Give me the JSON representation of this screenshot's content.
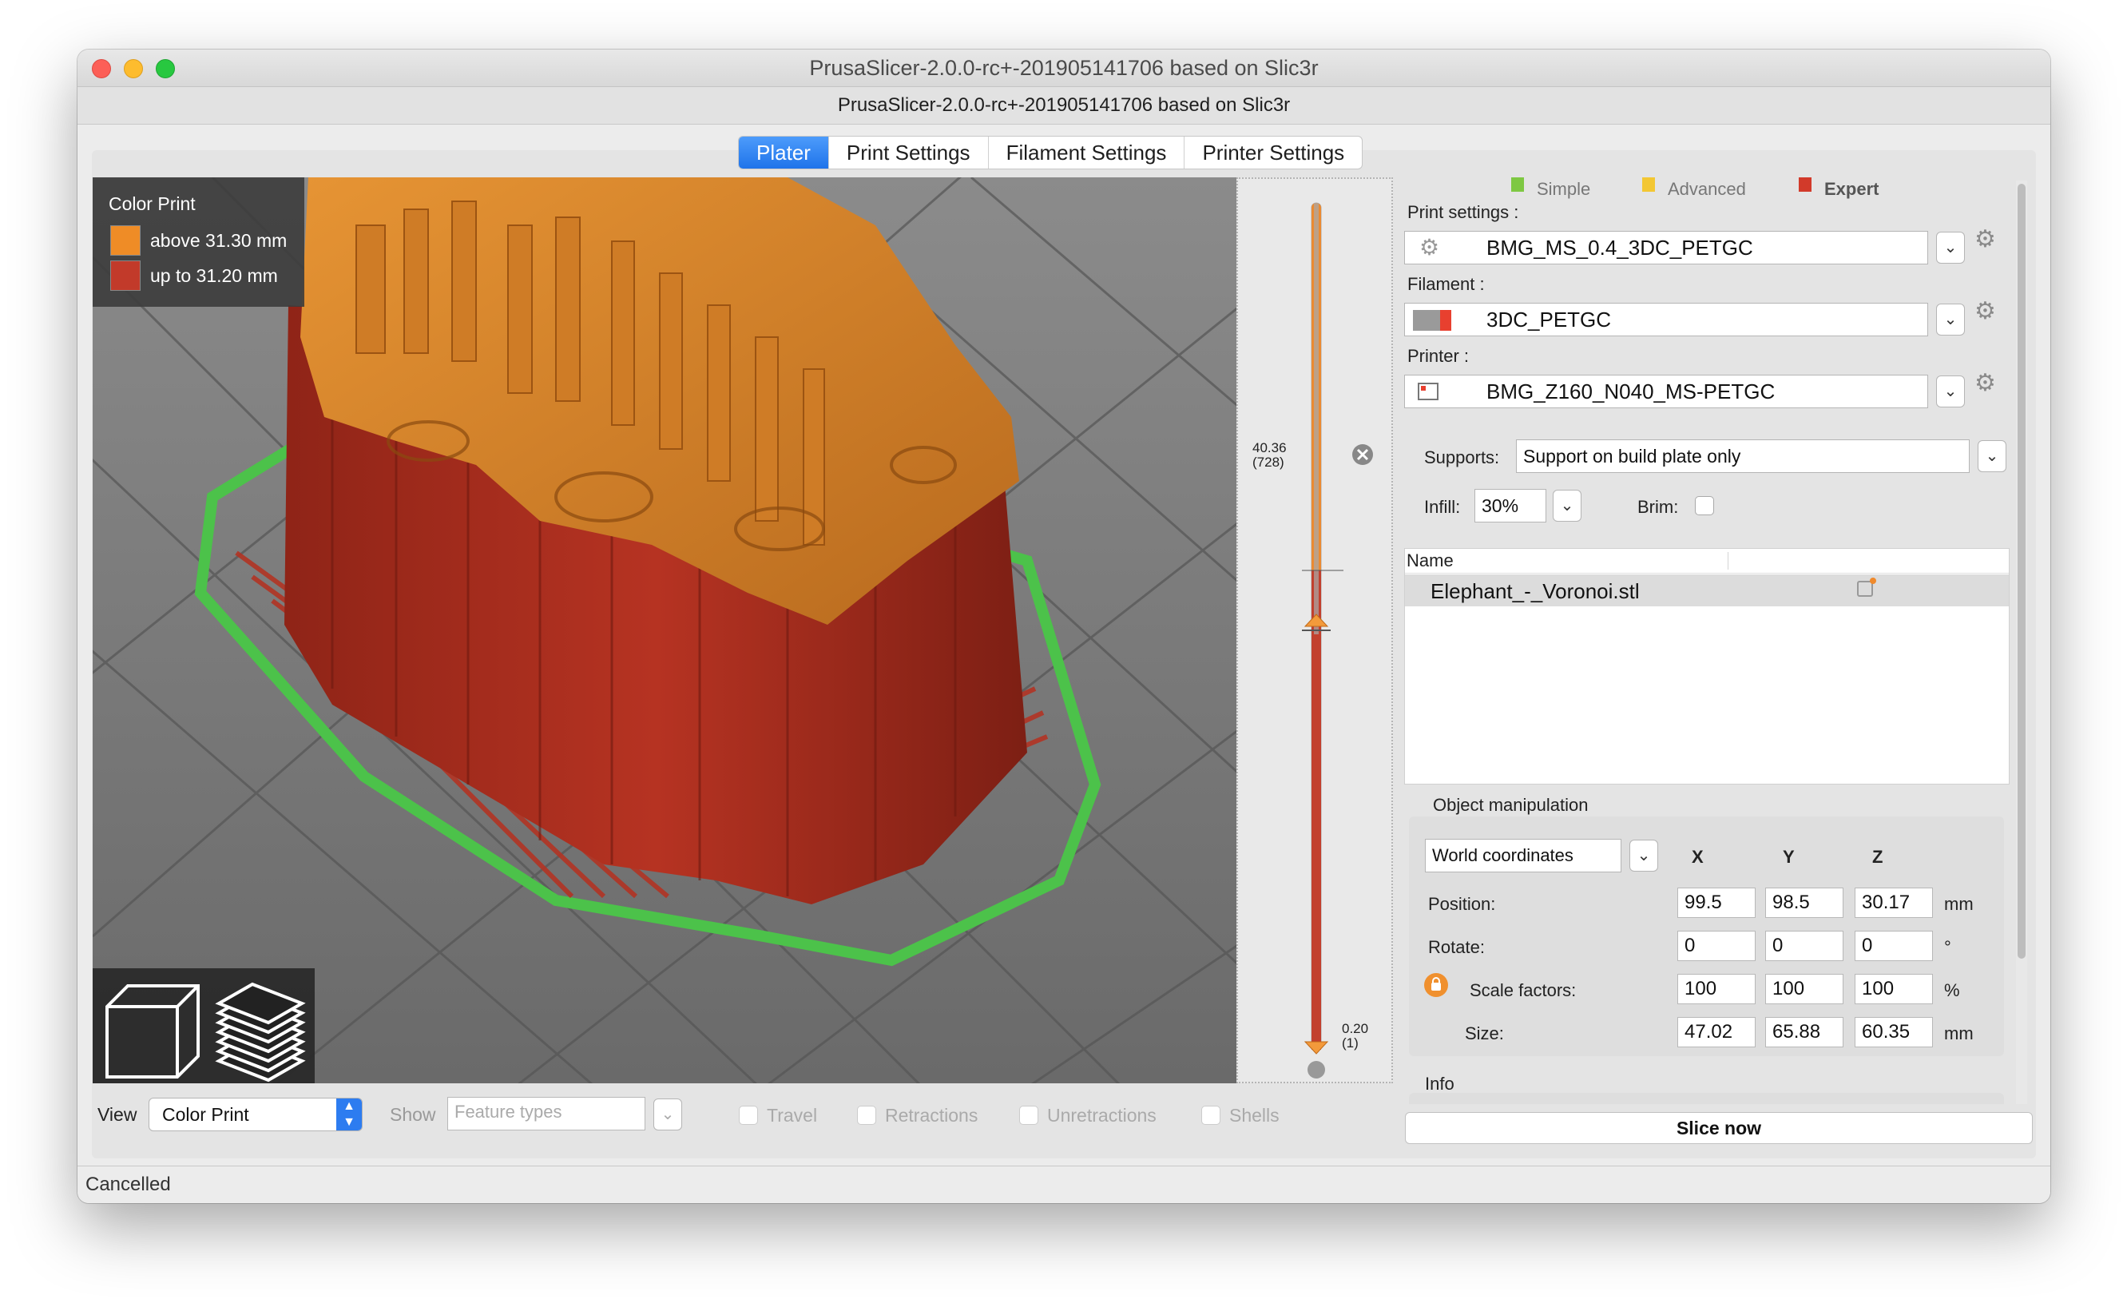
{
  "window": {
    "title": "PrusaSlicer-2.0.0-rc+-201905141706 based on Slic3r",
    "subtitle": "PrusaSlicer-2.0.0-rc+-201905141706 based on Slic3r"
  },
  "tabs": [
    {
      "label": "Plater",
      "active": true
    },
    {
      "label": "Print Settings",
      "active": false
    },
    {
      "label": "Filament Settings",
      "active": false
    },
    {
      "label": "Printer Settings",
      "active": false
    }
  ],
  "legend": {
    "title": "Color Print",
    "items": [
      {
        "label": "above 31.30 mm",
        "color": "#ef8c26"
      },
      {
        "label": "up to 31.20 mm",
        "color": "#c23a2a"
      }
    ]
  },
  "layer_slider": {
    "top_value": "40.36",
    "top_layer": "(728)",
    "bottom_value": "0.20",
    "bottom_layer": "(1)"
  },
  "modes": [
    {
      "label": "Simple",
      "color": "#7ec842"
    },
    {
      "label": "Advanced",
      "color": "#f3c733"
    },
    {
      "label": "Expert",
      "color": "#d23a2a"
    }
  ],
  "print_settings": {
    "label": "Print settings :",
    "value": "BMG_MS_0.4_3DC_PETGC"
  },
  "filament": {
    "label": "Filament :",
    "value": "3DC_PETGC",
    "color": "#e8402f"
  },
  "printer": {
    "label": "Printer :",
    "value": "BMG_Z160_N040_MS-PETGC"
  },
  "supports": {
    "label": "Supports:",
    "value": "Support on build plate only"
  },
  "infill": {
    "label": "Infill:",
    "value": "30%"
  },
  "brim": {
    "label": "Brim:"
  },
  "object_list": {
    "header": "Name",
    "items": [
      "Elephant_-_Voronoi.stl"
    ]
  },
  "object_manipulation": {
    "title": "Object manipulation",
    "coord_system": "World coordinates",
    "axes": [
      "X",
      "Y",
      "Z"
    ],
    "rows": [
      {
        "label": "Position:",
        "values": [
          "99.5",
          "98.5",
          "30.17"
        ],
        "unit": "mm"
      },
      {
        "label": "Rotate:",
        "values": [
          "0",
          "0",
          "0"
        ],
        "unit": "°"
      },
      {
        "label": "Scale factors:",
        "values": [
          "100",
          "100",
          "100"
        ],
        "unit": "%"
      },
      {
        "label": "Size:",
        "values": [
          "47.02",
          "65.88",
          "60.35"
        ],
        "unit": "mm"
      }
    ]
  },
  "info": {
    "title": "Info"
  },
  "slice_button": "Slice now",
  "bottom_toolbar": {
    "view_label": "View",
    "view_value": "Color Print",
    "show_label": "Show",
    "show_placeholder": "Feature types",
    "checkboxes": [
      "Travel",
      "Retractions",
      "Unretractions",
      "Shells"
    ]
  },
  "status": "Cancelled"
}
